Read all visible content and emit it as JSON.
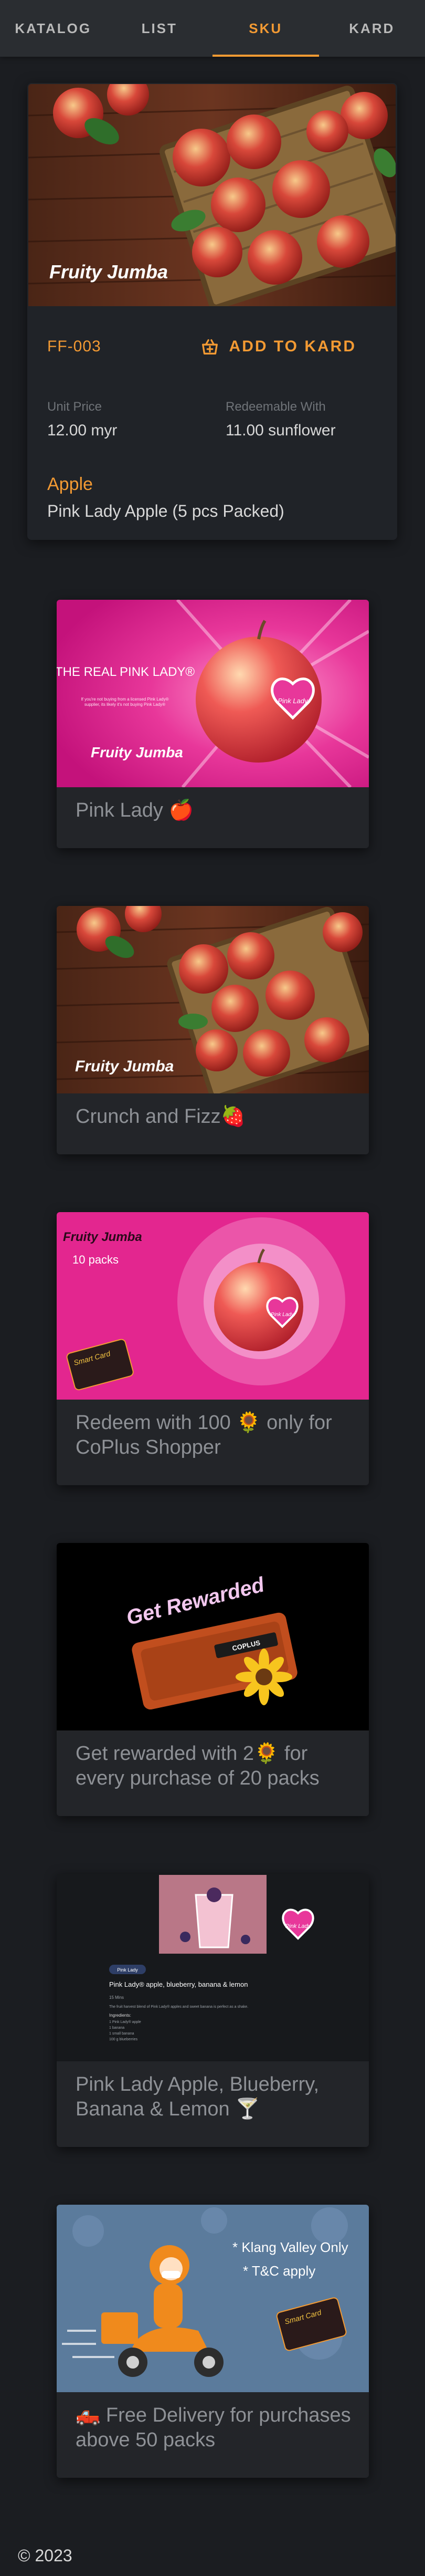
{
  "nav": {
    "tabs": [
      {
        "label": "KATALOG",
        "active": false
      },
      {
        "label": "LIST",
        "active": false
      },
      {
        "label": "SKU",
        "active": true
      },
      {
        "label": "KARD",
        "active": false
      }
    ],
    "accent_color": "#f39a33"
  },
  "product": {
    "brand_logo": "Fruity Jumba",
    "code": "FF-003",
    "add_label": "ADD TO KARD",
    "add_icon": "basket-plus-icon",
    "unit_price_label": "Unit Price",
    "unit_price": "12.00 myr",
    "redeemable_label": "Redeemable With",
    "redeemable": "11.00 sunflower",
    "category": "Apple",
    "name": "Pink Lady Apple (5 pcs Packed)"
  },
  "promos": [
    {
      "caption": "Pink Lady 🍎",
      "image": {
        "heading": "THE REAL PINK LADY®",
        "fine_print": "If you're not buying from a licensed Pink Lady® supplier, its likely it's not buying Pink Lady®",
        "logo": "Fruity Jumba",
        "badge": "Pink Lady"
      }
    },
    {
      "caption": "Crunch and Fizz🍓",
      "image": {
        "logo": "Fruity Jumba"
      }
    },
    {
      "caption": "Redeem with 100 🌻 only for CoPlus Shopper",
      "image": {
        "logo": "Fruity Jumba",
        "packs": "10 packs",
        "card_text": "Smart Card",
        "badge": "Pink Lady"
      }
    },
    {
      "caption": "Get rewarded with 2🌻 for every purchase of 20 packs",
      "image": {
        "heading": "Get Rewarded",
        "card_brand": "COPLUS"
      }
    },
    {
      "caption": "Pink Lady Apple, Blueberry, Banana & Lemon 🍸",
      "image": {
        "chip": "Pink Lady",
        "title": "Pink Lady® apple, blueberry, banana & lemon",
        "serves": "15 Mins",
        "intro": "The fruit harvest blend of Pink Lady® apples and sweet banana is perfect as a shake.",
        "ingredients_label": "Ingredients:",
        "ingredients": [
          "1 Pink Lady® apple",
          "1 banana",
          "1 small banana",
          "100 g blueberries"
        ],
        "badge": "Pink Lady"
      }
    },
    {
      "caption": "🛻 Free Delivery for purchases above 50 packs",
      "image": {
        "line1": "* Klang Valley Only",
        "line2": "* T&C apply",
        "card_text": "Smart Card"
      }
    }
  ],
  "footer": {
    "copyright": "© 2023"
  }
}
